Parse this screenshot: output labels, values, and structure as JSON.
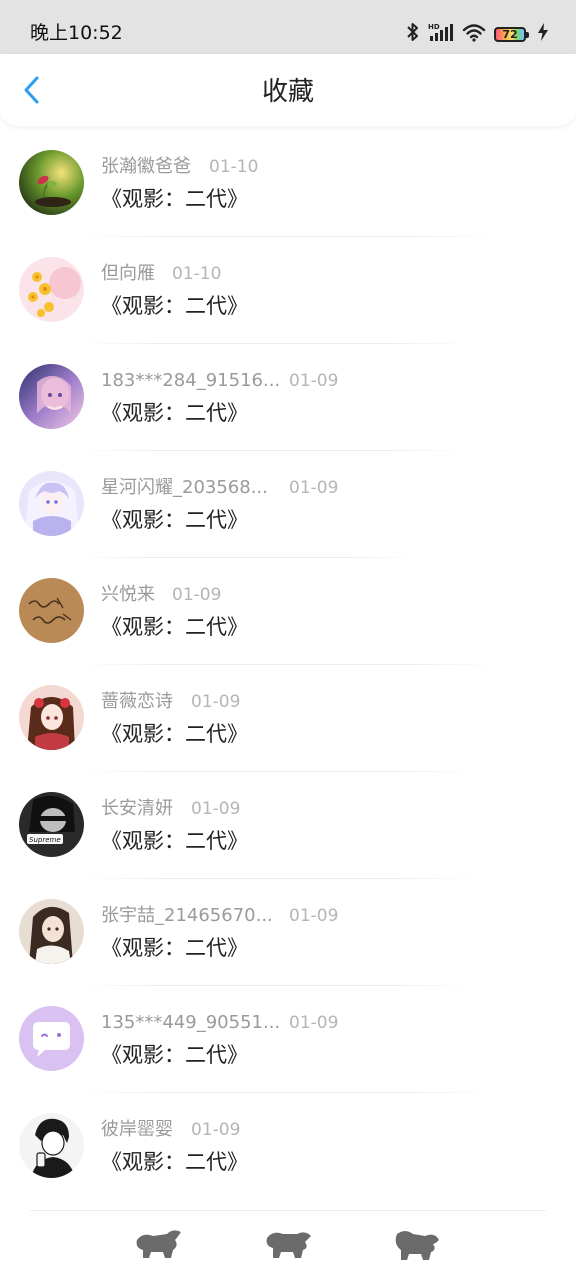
{
  "status_bar": {
    "time": "晚上10:52",
    "battery_level": "72",
    "icons": [
      "bluetooth-icon",
      "hd-signal-icon",
      "wifi-icon",
      "battery-icon",
      "charging-icon"
    ]
  },
  "header": {
    "title": "收藏",
    "back_icon": "chevron-left-icon",
    "accent_color": "#2a9df4"
  },
  "favorites": [
    {
      "user": "张瀚徽爸爸",
      "date": "01-10",
      "title": "《观影：二代》"
    },
    {
      "user": "但向雁",
      "date": "01-10",
      "title": "《观影：二代》"
    },
    {
      "user": "183***284_91516...",
      "date": "01-09",
      "title": "《观影：二代》"
    },
    {
      "user": "星河闪耀_203568...",
      "date": "01-09",
      "title": "《观影：二代》"
    },
    {
      "user": "兴悦来",
      "date": "01-09",
      "title": "《观影：二代》"
    },
    {
      "user": "蔷薇恋诗",
      "date": "01-09",
      "title": "《观影：二代》"
    },
    {
      "user": "长安清妍",
      "date": "01-09",
      "title": "《观影：二代》"
    },
    {
      "user": "张宇喆_21465670...",
      "date": "01-09",
      "title": "《观影：二代》"
    },
    {
      "user": "135***449_90551...",
      "date": "01-09",
      "title": "《观影：二代》"
    },
    {
      "user": "彼岸罂婴",
      "date": "01-09",
      "title": "《观影：二代》"
    }
  ]
}
